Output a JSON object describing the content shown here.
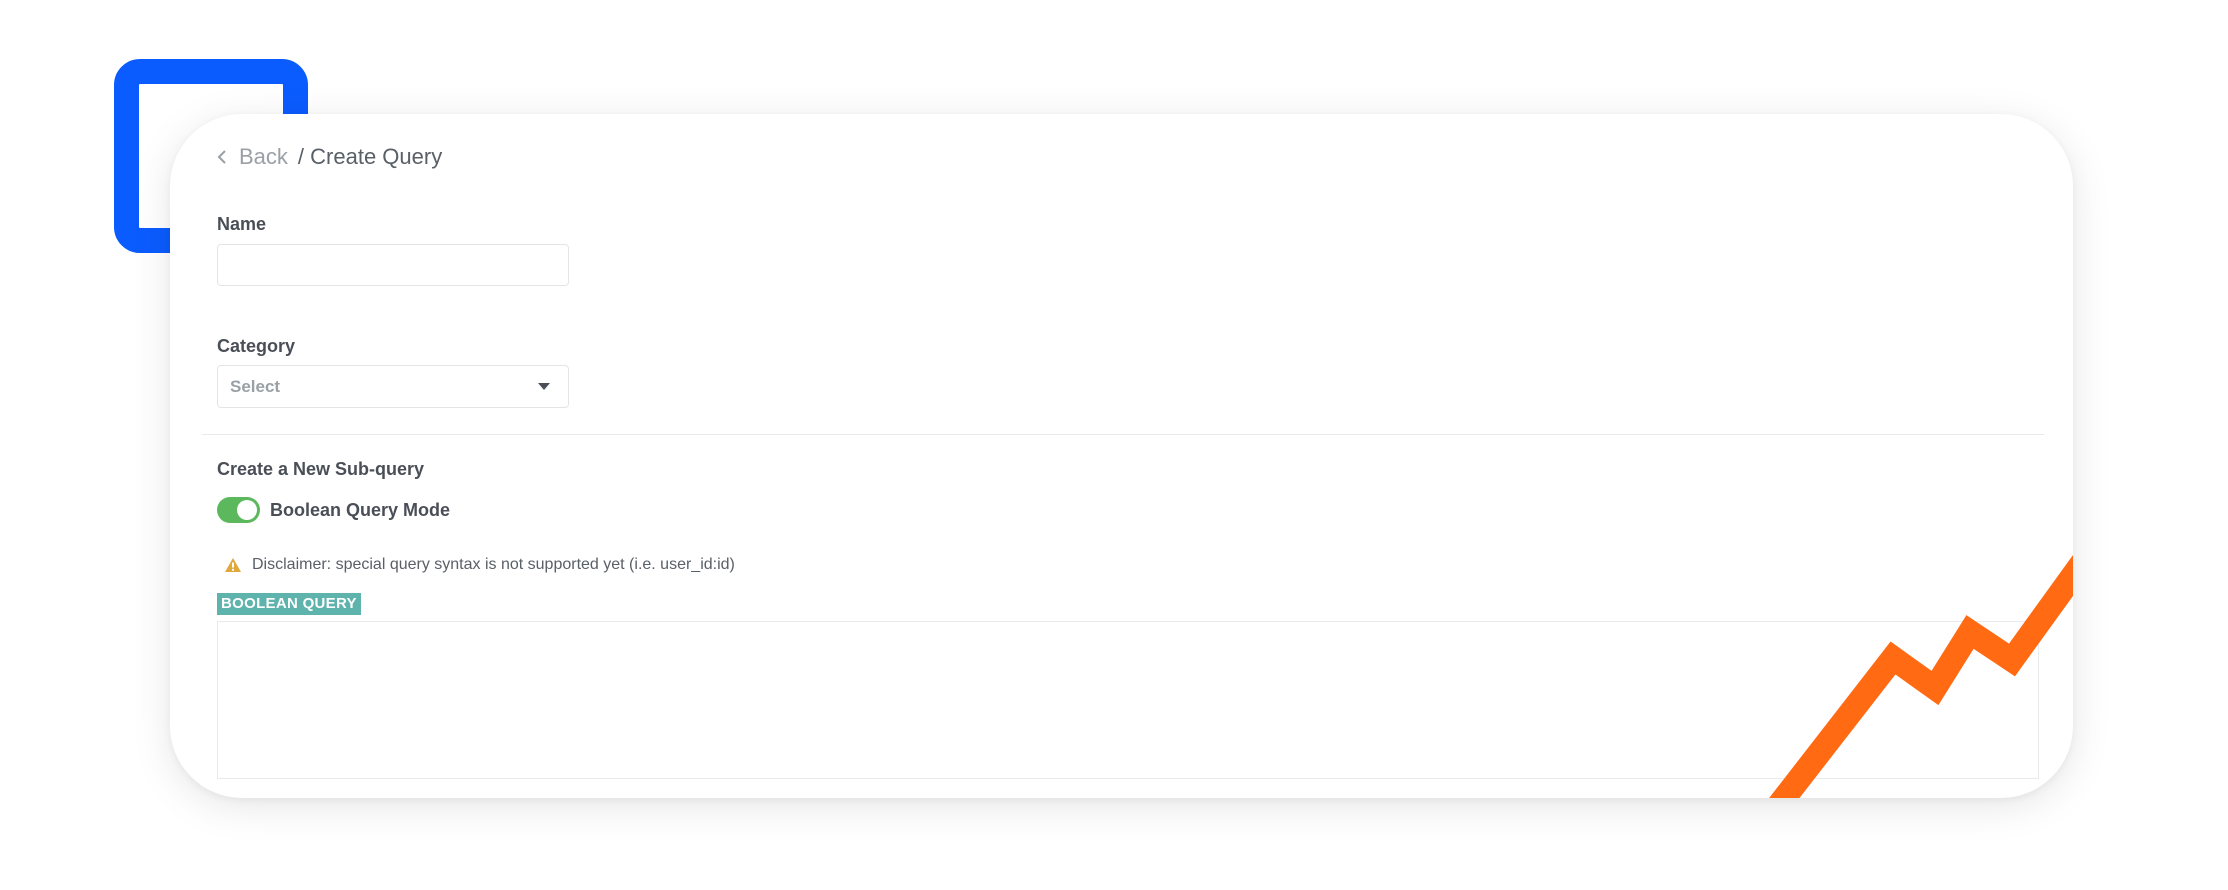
{
  "breadcrumb": {
    "back_label": "Back",
    "current": "/ Create Query"
  },
  "form": {
    "name_label": "Name",
    "name_value": "",
    "category_label": "Category",
    "category_placeholder": "Select",
    "subquery_heading": "Create a New Sub-query",
    "boolean_mode_label": "Boolean Query Mode",
    "boolean_mode_on": true,
    "disclaimer": "Disclaimer: special query syntax is not supported yet (i.e. user_id:id)",
    "boolean_query_badge": "BOOLEAN QUERY",
    "boolean_query_value": ""
  },
  "icons": {
    "back": "chevron-left-icon",
    "category_caret": "caret-down-icon",
    "warning": "warning-icon"
  },
  "colors": {
    "accent_blue": "#0b5cff",
    "accent_orange": "#ff6a13",
    "toggle_on": "#5cb85c",
    "badge_bg": "#5fb3ad",
    "warning": "#e0a83a"
  }
}
